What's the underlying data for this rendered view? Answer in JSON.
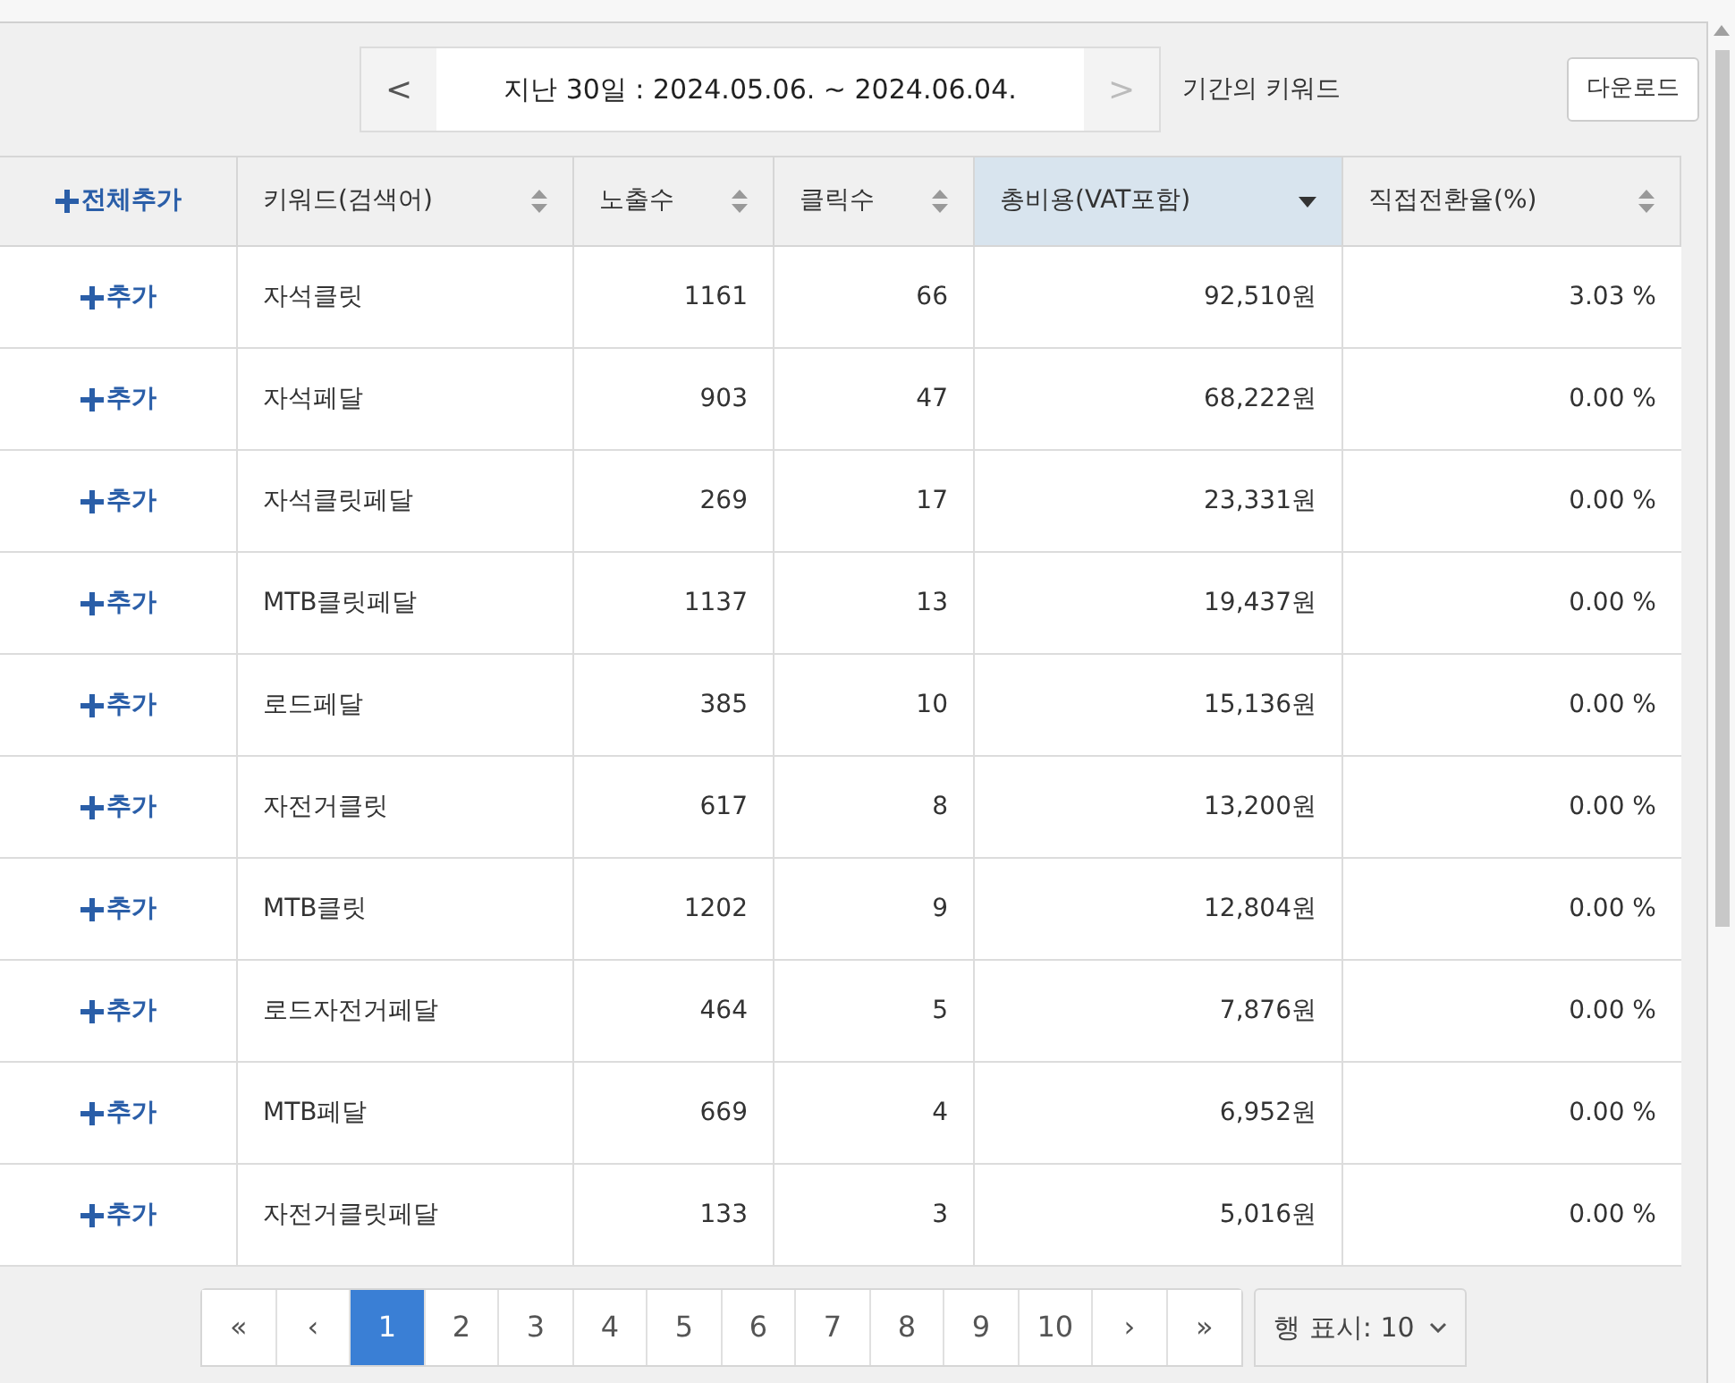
{
  "toolbar": {
    "prev": "<",
    "date_range": "지난 30일 : 2024.05.06. ~ 2024.06.04.",
    "next": ">",
    "period_label": "기간의 키워드",
    "download": "다운로드"
  },
  "table": {
    "add_all": "전체추가",
    "columns": [
      {
        "label": "키워드(검색어)",
        "selected": false
      },
      {
        "label": "노출수",
        "selected": false
      },
      {
        "label": "클릭수",
        "selected": false
      },
      {
        "label": "총비용(VAT포함)",
        "selected": true
      },
      {
        "label": "직접전환율(%)",
        "selected": false
      }
    ],
    "rows": [
      {
        "add": "추가",
        "cells": [
          "자석클릿",
          "1161",
          "66",
          "92,510원",
          "3.03 %"
        ]
      },
      {
        "add": "추가",
        "cells": [
          "자석페달",
          "903",
          "47",
          "68,222원",
          "0.00 %"
        ]
      },
      {
        "add": "추가",
        "cells": [
          "자석클릿페달",
          "269",
          "17",
          "23,331원",
          "0.00 %"
        ]
      },
      {
        "add": "추가",
        "cells": [
          "MTB클릿페달",
          "1137",
          "13",
          "19,437원",
          "0.00 %"
        ]
      },
      {
        "add": "추가",
        "cells": [
          "로드페달",
          "385",
          "10",
          "15,136원",
          "0.00 %"
        ]
      },
      {
        "add": "추가",
        "cells": [
          "자전거클릿",
          "617",
          "8",
          "13,200원",
          "0.00 %"
        ]
      },
      {
        "add": "추가",
        "cells": [
          "MTB클릿",
          "1202",
          "9",
          "12,804원",
          "0.00 %"
        ]
      },
      {
        "add": "추가",
        "cells": [
          "로드자전거페달",
          "464",
          "5",
          "7,876원",
          "0.00 %"
        ]
      },
      {
        "add": "추가",
        "cells": [
          "MTB페달",
          "669",
          "4",
          "6,952원",
          "0.00 %"
        ]
      },
      {
        "add": "추가",
        "cells": [
          "자전거클릿페달",
          "133",
          "3",
          "5,016원",
          "0.00 %"
        ]
      }
    ]
  },
  "pagination": {
    "first": "«",
    "prev": "‹",
    "pages": [
      {
        "label": "1",
        "selected": true
      },
      {
        "label": "2",
        "selected": false
      },
      {
        "label": "3",
        "selected": false
      },
      {
        "label": "4",
        "selected": false
      },
      {
        "label": "5",
        "selected": false
      },
      {
        "label": "6",
        "selected": false
      },
      {
        "label": "7",
        "selected": false
      },
      {
        "label": "8",
        "selected": false
      },
      {
        "label": "9",
        "selected": false
      },
      {
        "label": "10",
        "selected": false
      }
    ],
    "next": "›",
    "last": "»",
    "rows_per_page": "행 표시: 10"
  }
}
